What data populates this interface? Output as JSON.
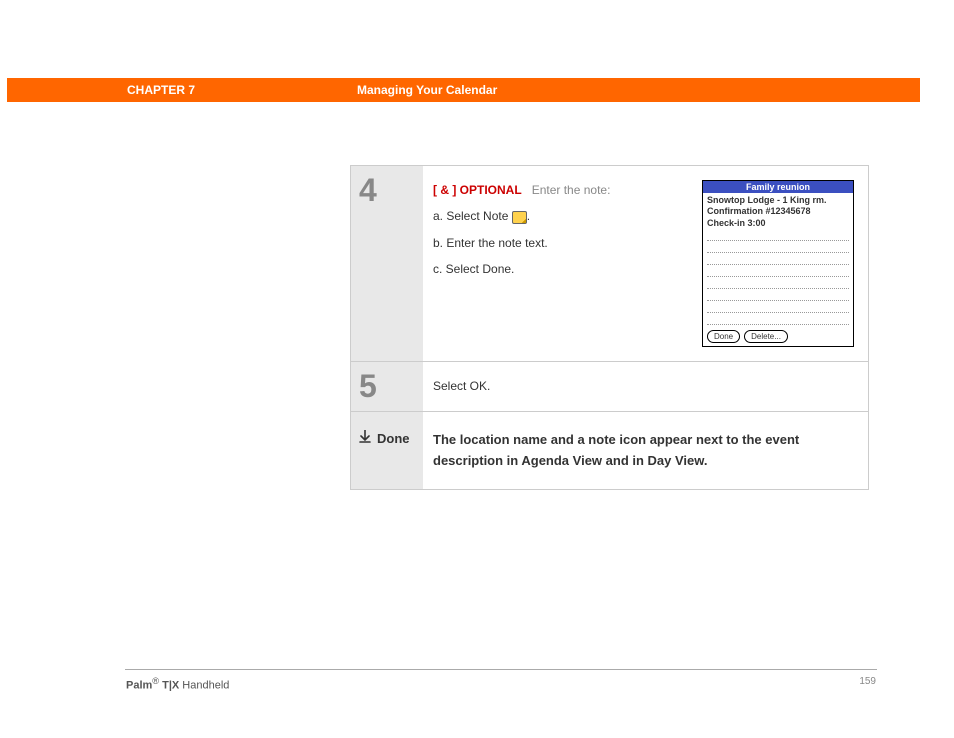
{
  "header": {
    "chapter": "CHAPTER 7",
    "title": "Managing Your Calendar"
  },
  "steps": {
    "s4": {
      "num": "4",
      "optional_bracket": "[ & ]  OPTIONAL",
      "lead": "Enter the note:",
      "a": "a.  Select Note ",
      "a_tail": ".",
      "b": "b.  Enter the note text.",
      "c": "c.  Select Done.",
      "palm": {
        "title": "Family reunion",
        "line1": "Snowtop Lodge - 1 King rm.",
        "line2": "Confirmation #12345678",
        "line3": "Check-in 3:00",
        "btn_done": "Done",
        "btn_delete": "Delete..."
      }
    },
    "s5": {
      "num": "5",
      "text": "Select OK."
    },
    "done": {
      "label": "Done",
      "text": "The location name and a note icon appear next to the event description in Agenda View and in Day View."
    }
  },
  "footer": {
    "brand_bold": "Palm",
    "brand_sup": "®",
    "brand_model": " T|X",
    "brand_tail": " Handheld",
    "page": "159"
  }
}
